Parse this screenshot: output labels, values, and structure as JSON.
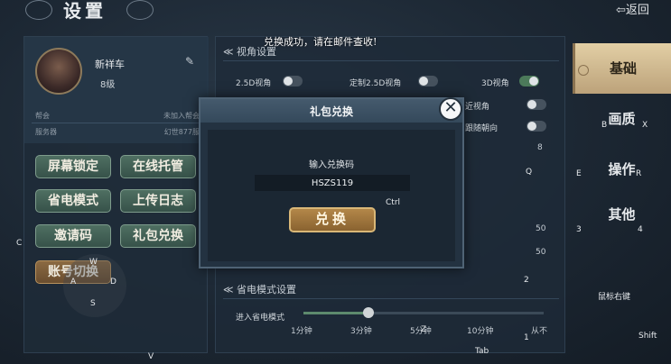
{
  "header": {
    "title": "设置",
    "back_label": "返回"
  },
  "toast": "兑换成功，请在邮件查收!",
  "profile": {
    "name": "新祥车",
    "level": "8级",
    "guild_label": "帮会",
    "guild_value": "未加入帮会",
    "server_label": "服务器",
    "server_value": "幻世877服"
  },
  "actions": [
    {
      "label": "屏幕锁定"
    },
    {
      "label": "在线托管"
    },
    {
      "label": "省电模式"
    },
    {
      "label": "上传日志"
    },
    {
      "label": "邀请码"
    },
    {
      "label": "礼包兑换"
    },
    {
      "label": "账号切换"
    }
  ],
  "view_section": {
    "title": "视角设置",
    "options": [
      {
        "label": "2.5D视角",
        "on": false
      },
      {
        "label": "定制2.5D视角",
        "on": false
      },
      {
        "label": "3D视角",
        "on": true
      },
      {
        "label": "近视角",
        "on": false
      },
      {
        "label": "跟随朝向",
        "on": false
      }
    ],
    "slider_value_1": "8",
    "slider_value_2": "50",
    "slider_value_3": "50"
  },
  "power_section": {
    "title": "省电模式设置",
    "row_label": "进入省电模式",
    "ticks": [
      "1分钟",
      "3分钟",
      "5分钟",
      "10分钟",
      "从不"
    ],
    "level": 0.27
  },
  "tabs": [
    {
      "label": "基础",
      "active": true
    },
    {
      "label": "画质",
      "active": false
    },
    {
      "label": "操作",
      "active": false
    },
    {
      "label": "其他",
      "active": false
    }
  ],
  "key_hints": {
    "b": "B",
    "x": "X",
    "q": "Q",
    "e": "E",
    "r": "R",
    "three": "3",
    "four": "4",
    "two": "2",
    "one": "1",
    "c": "C",
    "w": "W",
    "a": "A",
    "s": "S",
    "d": "D",
    "v": "V",
    "z": "Z",
    "tab": "Tab",
    "shift": "Shift",
    "ctrl": "Ctrl",
    "right_mouse": "鼠标右键"
  },
  "dialog": {
    "title": "礼包兑换",
    "code_label": "输入兑换码",
    "code_value": "HSZS119",
    "redeem_label": "兑换"
  }
}
